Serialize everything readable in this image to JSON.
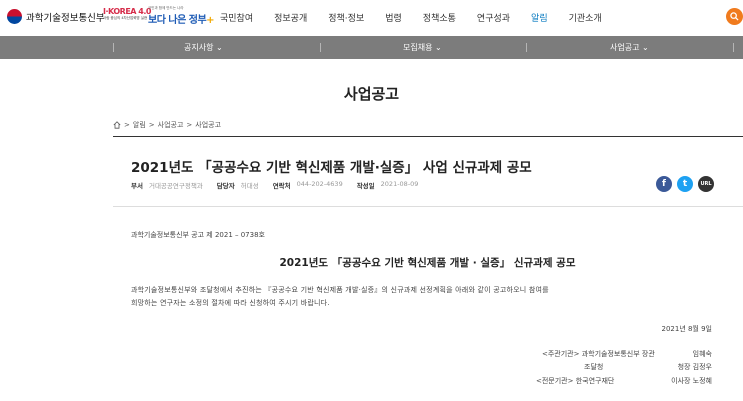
{
  "header": {
    "logo_text": "과학기술정보통신부",
    "ikorea_title": "I·KOREA 4.0",
    "ikorea_sub": "사람 중심의 4차산업혁명 실현",
    "gov_sub": "국민과 함께 만드는 나라",
    "gov_title": "보다 나은 정부",
    "gnb": [
      "국민참여",
      "정보공개",
      "정책·정보",
      "법령",
      "정책소통",
      "연구성과",
      "알림",
      "기관소개"
    ],
    "active_gnb": "알림"
  },
  "subnav": {
    "items": [
      "공지사항",
      "모집채용",
      "사업공고"
    ]
  },
  "page_title": "사업공고",
  "breadcrumb": [
    "알림",
    "사업공고",
    "사업공고"
  ],
  "post": {
    "title": "2021년도 「공공수요 기반 혁신제품 개발·실증」 사업 신규과제 공모",
    "meta": {
      "dept_label": "부서",
      "dept_value": "거대공공연구정책과",
      "manager_label": "담당자",
      "manager_value": "허대성",
      "phone_label": "연락처",
      "phone_value": "044-202-4639",
      "date_label": "작성일",
      "date_value": "2021-08-09"
    },
    "share": {
      "facebook": "f",
      "twitter": "t",
      "url": "URL"
    }
  },
  "content": {
    "notice_no": "과학기술정보통신부 공고 제 2021 – 0738호",
    "notice_title": "2021년도 「공공수요 기반 혁신제품 개발 · 실증」 신규과제 공모",
    "para1": "과학기술정보통신부와 조달청에서 추진하는 『공공수요 기반 혁신제품 개발·실증』의 신규과제 선정계획을 아래와 같이 공고하오니 참여를",
    "para2": "희망하는 연구자는 소정의 절차에 따라 신청하여 주시기 바랍니다.",
    "date": "2021년  8월  9일",
    "sig1_left": "<주관기관>  과학기술정보통신부 장관",
    "sig1_right": "임혜숙",
    "sig2_left": "조달청",
    "sig2_right": "청장  김정우",
    "sig3_left": "<전문기관>  한국연구재단",
    "sig3_right": "이사장  노정혜"
  },
  "colors": {
    "accent": "#0a7bc1",
    "subnav_bg": "#7c7c7c",
    "search_btn": "#f07b1e",
    "facebook": "#3b5998",
    "twitter": "#1da1f2"
  }
}
